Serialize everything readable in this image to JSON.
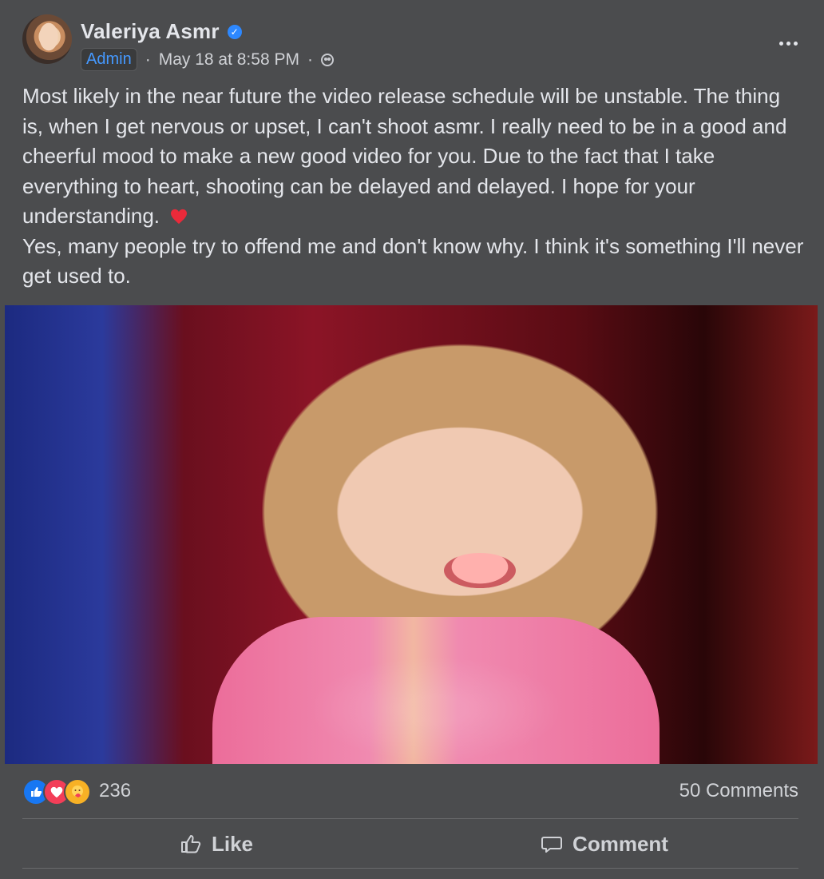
{
  "post": {
    "author": "Valeriya Asmr",
    "badge": "Admin",
    "timestamp": "May 18 at 8:58 PM",
    "separator_1": "·",
    "separator_2": "·",
    "text_p1": "Most likely in the near future the video release schedule will be unstable. The thing is, when I get nervous or upset, I can't shoot asmr. I really need to be in a good and cheerful mood to make a new good video for you. Due to the fact that I take everything to heart, shooting can be delayed and delayed. I hope for your understanding.",
    "text_p2": "Yes, many people try to offend me and don't know why. I think it's something I'll never get used to.",
    "reactions_count": "236",
    "comments_label": "50 Comments"
  },
  "actions": {
    "like_label": "Like",
    "comment_label": "Comment"
  },
  "icons": {
    "verified": "verified-badge-icon",
    "privacy": "friends-privacy-icon",
    "more": "more-options-icon",
    "heart": "heart-emoji-icon",
    "like": "like-reaction-icon",
    "love": "love-reaction-icon",
    "care": "care-reaction-icon"
  },
  "colors": {
    "card_bg": "#4b4c4e",
    "accent_blue": "#2d88ff",
    "text_primary": "#e4e6eb"
  }
}
